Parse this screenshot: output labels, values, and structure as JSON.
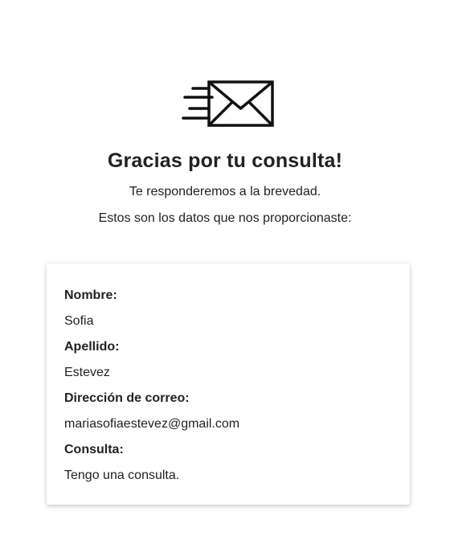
{
  "icon": "mail-fast-icon",
  "heading": {
    "title": "Gracias por tu consulta!",
    "line1": "Te responderemos a la brevedad.",
    "line2": "Estos son los datos que nos proporcionaste:"
  },
  "summary": {
    "fields": [
      {
        "label": "Nombre:",
        "value": "Sofia"
      },
      {
        "label": "Apellido:",
        "value": "Estevez"
      },
      {
        "label": "Dirección de correo:",
        "value": "mariasofiaestevez@gmail.com"
      },
      {
        "label": "Consulta:",
        "value": "Tengo una consulta."
      }
    ]
  },
  "colors": {
    "text": "#222222",
    "background": "#ffffff",
    "icon": "#111111"
  }
}
